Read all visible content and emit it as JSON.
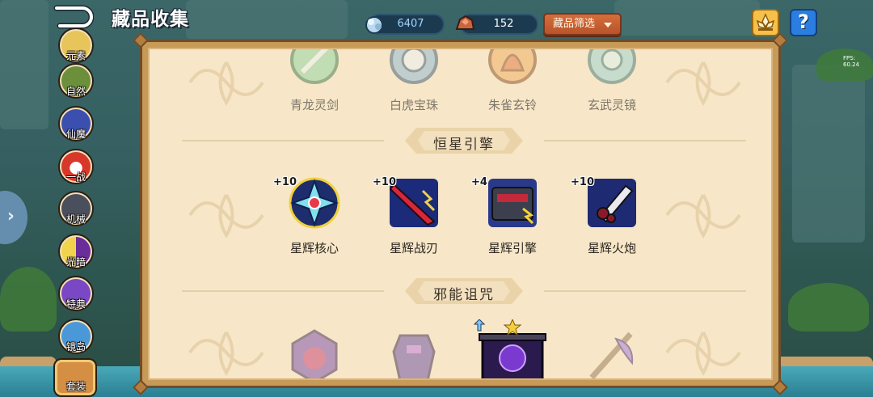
{
  "header": {
    "title": "藏品收集",
    "back_icon": "back-arrow-icon",
    "fps": "FPS: 60.24"
  },
  "currencies": [
    {
      "name": "gem",
      "icon": "crystal-icon",
      "value": "6407"
    },
    {
      "name": "ore",
      "icon": "ore-icon",
      "value": "152"
    }
  ],
  "filter": {
    "label": "藏品筛选"
  },
  "top_right": {
    "shop_icon": "lotus-shop-icon",
    "help_label": "?"
  },
  "sidebar": {
    "items": [
      {
        "label": "元素",
        "icon": "element-icon"
      },
      {
        "label": "自然",
        "icon": "tree-icon"
      },
      {
        "label": "仙魔",
        "icon": "demon-icon"
      },
      {
        "label": "一战",
        "icon": "pokeball-icon"
      },
      {
        "label": "机械",
        "icon": "mech-icon"
      },
      {
        "label": "光暗",
        "icon": "light-dark-icon"
      },
      {
        "label": "特典",
        "icon": "special-icon"
      },
      {
        "label": "镜岛",
        "icon": "mirror-isle-icon"
      },
      {
        "label": "套装",
        "icon": "set-icon",
        "active": true
      }
    ]
  },
  "sections": [
    {
      "title": "",
      "items": [
        {
          "name": "青龙灵剑",
          "level": "",
          "collected": false
        },
        {
          "name": "白虎宝珠",
          "level": "",
          "collected": false
        },
        {
          "name": "朱雀玄铃",
          "level": "",
          "collected": false
        },
        {
          "name": "玄武灵镜",
          "level": "",
          "collected": false
        }
      ]
    },
    {
      "title": "恒星引擎",
      "items": [
        {
          "name": "星辉核心",
          "level": "+10",
          "collected": true
        },
        {
          "name": "星辉战刃",
          "level": "+10",
          "collected": true
        },
        {
          "name": "星辉引擎",
          "level": "+4",
          "collected": true
        },
        {
          "name": "星辉火炮",
          "level": "+10",
          "collected": true
        }
      ]
    },
    {
      "title": "邪能诅咒",
      "items": [
        {
          "name": "",
          "level": "",
          "collected": false
        },
        {
          "name": "",
          "level": "",
          "collected": false
        },
        {
          "name": "",
          "level": "",
          "collected": true,
          "star": true,
          "upgrade": true
        },
        {
          "name": "",
          "level": "",
          "collected": false
        }
      ]
    }
  ],
  "colors": {
    "panel_bg": "#f7e7c8",
    "filter_btn": "#c9602f",
    "help_btn": "#2b7ee0",
    "shop_btn": "#f6c04b"
  }
}
